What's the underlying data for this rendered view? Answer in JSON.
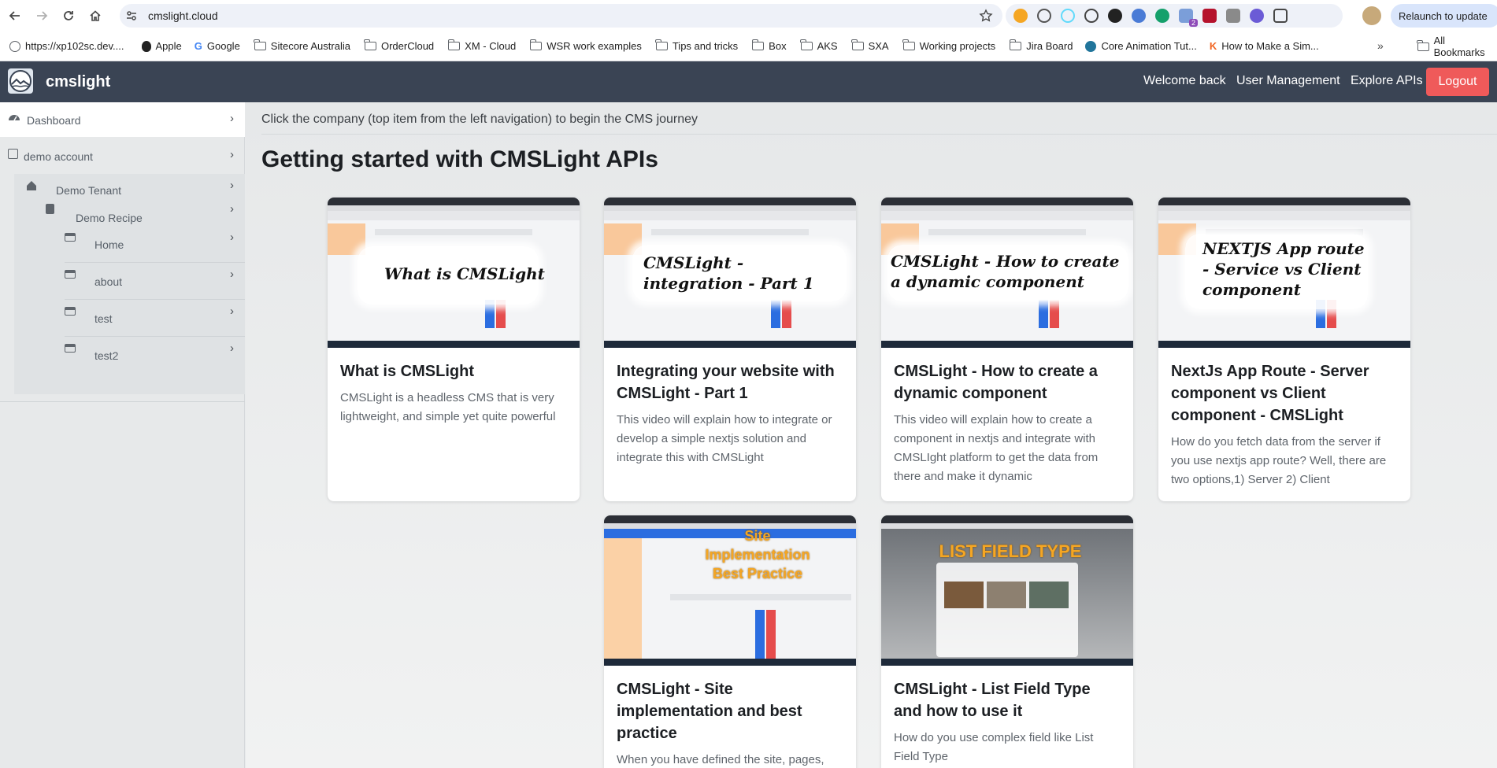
{
  "browser": {
    "url": "cmslight.cloud",
    "relaunch_label": "Relaunch to update",
    "ext_badge": "2"
  },
  "bookmarks": {
    "items": [
      {
        "label": "https://xp102sc.dev....",
        "icon": "globe-icon"
      },
      {
        "label": "Apple",
        "icon": "apple-icon"
      },
      {
        "label": "Google",
        "icon": "google-icon"
      },
      {
        "label": "Sitecore Australia",
        "icon": "folder-icon"
      },
      {
        "label": "OrderCloud",
        "icon": "folder-icon"
      },
      {
        "label": "XM - Cloud",
        "icon": "folder-icon"
      },
      {
        "label": "WSR work examples",
        "icon": "folder-icon"
      },
      {
        "label": "Tips and tricks",
        "icon": "folder-icon"
      },
      {
        "label": "Box",
        "icon": "folder-icon"
      },
      {
        "label": "AKS",
        "icon": "folder-icon"
      },
      {
        "label": "SXA",
        "icon": "folder-icon"
      },
      {
        "label": "Working projects",
        "icon": "folder-icon"
      },
      {
        "label": "Jira Board",
        "icon": "folder-icon"
      },
      {
        "label": "Core Animation Tut...",
        "icon": "wordpress-icon"
      },
      {
        "label": "How to Make a Sim...",
        "icon": "k-icon"
      }
    ],
    "more": "»",
    "all_bookmarks": "All Bookmarks"
  },
  "navbar": {
    "brand": "cmslight",
    "welcome": "Welcome back",
    "user_management": "User Management",
    "explore_apis": "Explore APIs",
    "logout": "Logout"
  },
  "sidebar": {
    "dashboard": "Dashboard",
    "account": "demo account",
    "tenant": "Demo Tenant",
    "recipe": "Demo Recipe",
    "pages": [
      "Home",
      "about",
      "test",
      "test2"
    ]
  },
  "main": {
    "hint": "Click the company (top item from the left navigation) to begin the CMS journey",
    "title": "Getting started with CMSLight APIs"
  },
  "cards": [
    {
      "thumb_text": "What is CMSLight",
      "title": "What is CMSLight",
      "desc": "CMSLight is a headless CMS that is very lightweight, and simple yet quite powerful"
    },
    {
      "thumb_text": "CMSLight - integration - Part 1",
      "title": "Integrating your website with CMSLight - Part 1",
      "desc": "This video will explain how to integrate or develop a simple nextjs solution and integrate this with CMSLight"
    },
    {
      "thumb_text": "CMSLight - How to create a dynamic component",
      "title": "CMSLight - How to create a dynamic component",
      "desc": "This video will explain how to create a component in nextjs and integrate with CMSLIght platform to get the data from there and make it dynamic"
    },
    {
      "thumb_text": "NEXTJS App route - Service vs Client component",
      "title": "NextJs App Route - Server component vs Client component - CMSLight",
      "desc": "How do you fetch data from the server if you use nextjs app route? Well, there are two options,1) Server 2) Client"
    },
    {
      "thumb_text": "Site Implementation Best Practice",
      "title": "CMSLight - Site implementation and best practice",
      "desc": "When you have defined the site, pages,"
    },
    {
      "thumb_text": "LIST FIELD TYPE",
      "title": "CMSLight - List Field Type and how to use it",
      "desc": "How do you use complex field like List Field Type"
    }
  ],
  "colors": {
    "navbar": "#3a4454",
    "logout": "#ef5a5a",
    "accent_orange": "#f5a623"
  }
}
